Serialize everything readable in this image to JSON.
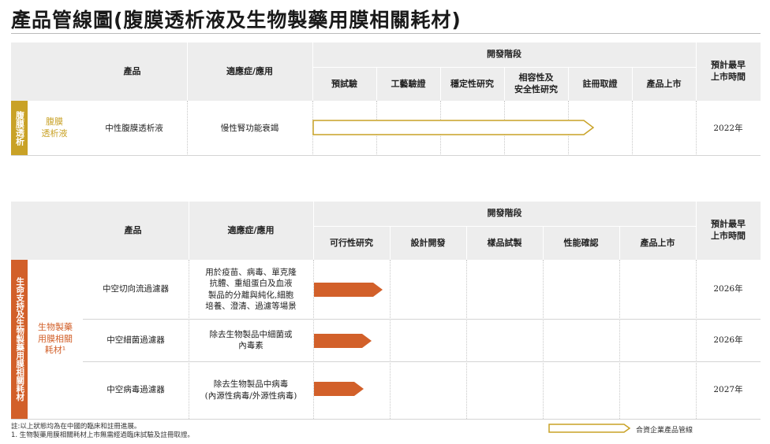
{
  "title": "產品管線圖(腹膜透析液及生物製藥用膜相關耗材)",
  "table1": {
    "headers": {
      "product": "產品",
      "indication": "適應症/應用",
      "stage_group": "開發階段",
      "earliest": "預計最早\n上市時間"
    },
    "stages": [
      "預試驗",
      "工藝驗證",
      "穩定性研究",
      "相容性及\n安全性研究",
      "註冊取證",
      "產品上市"
    ],
    "side_label": "腹膜透析",
    "category": "腹膜\n透析液",
    "rows": [
      {
        "product": "中性腹膜透析液",
        "indication": "慢性腎功能衰竭",
        "year": "2022年",
        "progress": 0.73,
        "style": "outline"
      }
    ],
    "colors": {
      "accent": "#c9a227"
    }
  },
  "table2": {
    "headers": {
      "product": "產品",
      "indication": "適應症/應用",
      "stage_group": "開發階段",
      "earliest": "預計最早\n上市時間"
    },
    "stages": [
      "可行性研究",
      "設計開發",
      "樣品試製",
      "性能確認",
      "產品上市"
    ],
    "side_label": "生命支持及生物製藥用膜相關耗材",
    "category": "生物製藥\n用膜相關\n耗材¹",
    "rows": [
      {
        "product": "中空切向流過濾器",
        "indication": "用於疫苗、病毒、單克隆\n抗體、重組蛋白及血液\n製品的分離與純化,細胞\n培養、澄清、過濾等場景",
        "year": "2026年",
        "progress": 0.18,
        "style": "filled"
      },
      {
        "product": "中空細菌過濾器",
        "indication": "除去生物製品中細菌或\n內毒素",
        "year": "2026年",
        "progress": 0.15,
        "style": "filled"
      },
      {
        "product": "中空病毒過濾器",
        "indication": "除去生物製品中病毒\n(內源性病毒/外源性病毒)",
        "year": "2027年",
        "progress": 0.13,
        "style": "filled"
      }
    ],
    "colors": {
      "accent": "#d2602a"
    }
  },
  "footnotes": {
    "note": "註:以上狀態均為在中國的臨床和註冊進展。",
    "note1": "1. 生物製藥用膜相關耗材上市無需經過臨床試驗及註冊取證。"
  },
  "legend": {
    "label": "合資企業產品管線"
  }
}
